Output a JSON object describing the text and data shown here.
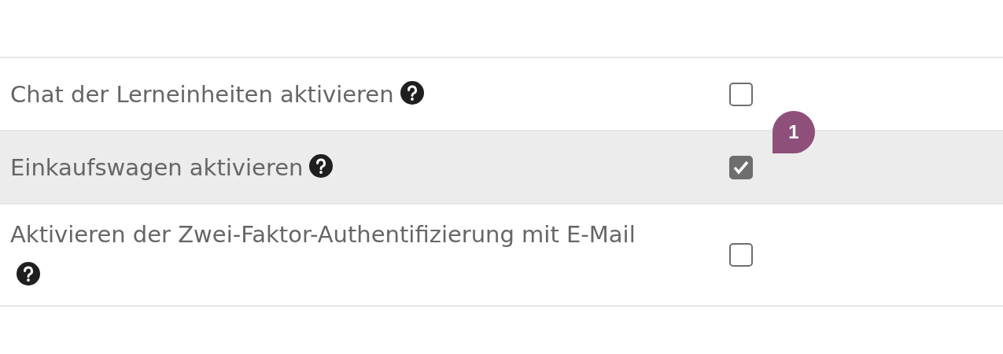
{
  "settings": [
    {
      "label": "Chat der Lerneinheiten aktivieren",
      "checked": false,
      "highlighted": false
    },
    {
      "label": "Einkaufswagen aktivieren",
      "checked": true,
      "highlighted": true,
      "callout": "1"
    },
    {
      "label": "Aktivieren der Zwei-Faktor-Authentifizierung mit E-Mail",
      "checked": false,
      "highlighted": false
    }
  ]
}
